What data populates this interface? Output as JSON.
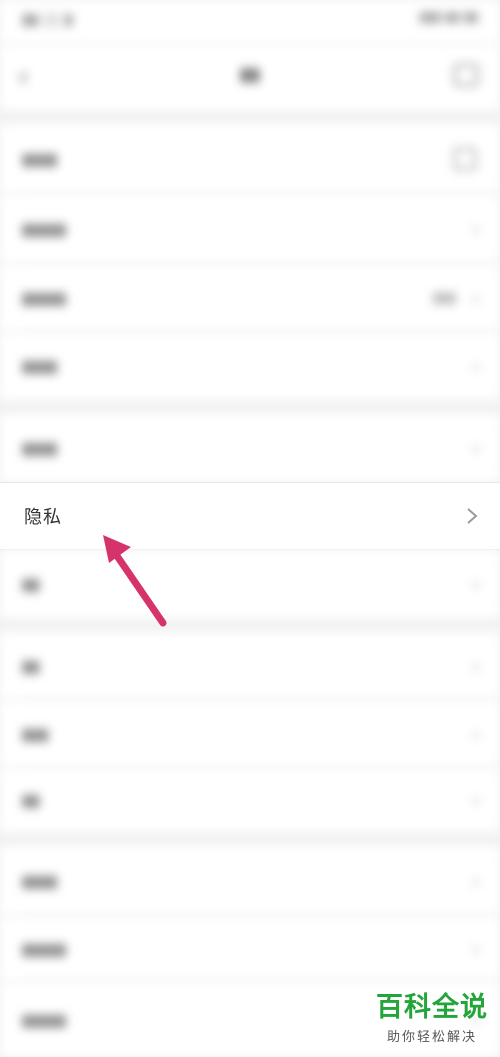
{
  "focus_row": {
    "label": "隐私"
  },
  "watermark": {
    "title": "百科全说",
    "subtitle": "助你轻松解决"
  },
  "arrow_color": "#d6336c"
}
